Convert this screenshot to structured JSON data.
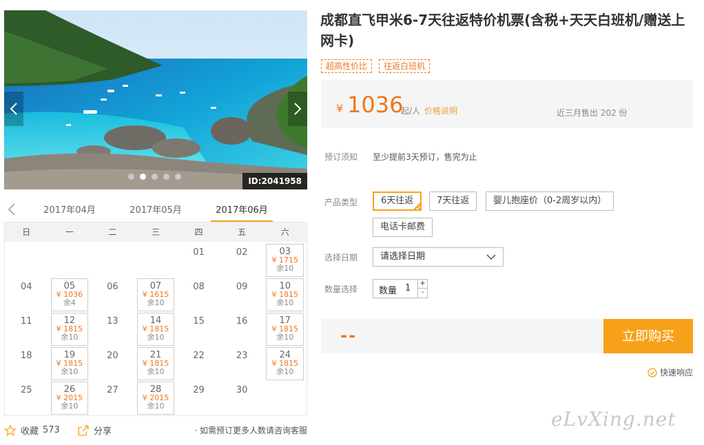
{
  "product": {
    "title": "成都直飞甲米6-7天往返特价机票(含税+天天白班机/赠送上网卡)",
    "tags": [
      "超高性价比",
      "往返白班机"
    ],
    "photo_id": "ID:2041958"
  },
  "price": {
    "currency": "¥",
    "amount": "1036",
    "unit": "起/人",
    "explain_label": "价格说明",
    "sold": "近三月售出 202 份"
  },
  "booking": {
    "notice_label": "预订须知",
    "notice_text": "至少提前3天预订，售完为止",
    "type_label": "产品类型",
    "types": [
      "6天往返",
      "7天往返",
      "婴儿抱座价（0-2周岁以内）",
      "电话卡邮费"
    ],
    "selected_type": "6天往返",
    "date_label": "选择日期",
    "date_placeholder": "请选择日期",
    "qty_label": "数量选择",
    "qty_prefix": "数量",
    "qty_value": "1",
    "qty_plus": "+",
    "qty_minus": "-"
  },
  "buy": {
    "total": "--",
    "button": "立即购买",
    "quick_response": "快速响应"
  },
  "calendar": {
    "months": [
      "2017年04月",
      "2017年05月",
      "2017年06月"
    ],
    "active_month": "2017年06月",
    "weekdays": [
      "日",
      "一",
      "二",
      "三",
      "四",
      "五",
      "六"
    ],
    "leading_blanks": 4,
    "days": [
      {
        "d": "01"
      },
      {
        "d": "02"
      },
      {
        "d": "03",
        "price": "¥ 1715",
        "stock": "余10"
      },
      {
        "d": "04"
      },
      {
        "d": "05",
        "price": "¥ 1036",
        "stock": "余4"
      },
      {
        "d": "06"
      },
      {
        "d": "07",
        "price": "¥ 1615",
        "stock": "余10"
      },
      {
        "d": "08"
      },
      {
        "d": "09"
      },
      {
        "d": "10",
        "price": "¥ 1815",
        "stock": "余10"
      },
      {
        "d": "11"
      },
      {
        "d": "12",
        "price": "¥ 1815",
        "stock": "余10"
      },
      {
        "d": "13"
      },
      {
        "d": "14",
        "price": "¥ 1815",
        "stock": "余10"
      },
      {
        "d": "15"
      },
      {
        "d": "16"
      },
      {
        "d": "17",
        "price": "¥ 1815",
        "stock": "余10"
      },
      {
        "d": "18"
      },
      {
        "d": "19",
        "price": "¥ 1815",
        "stock": "余10"
      },
      {
        "d": "20"
      },
      {
        "d": "21",
        "price": "¥ 1815",
        "stock": "余10"
      },
      {
        "d": "22"
      },
      {
        "d": "23"
      },
      {
        "d": "24",
        "price": "¥ 1815",
        "stock": "余10"
      },
      {
        "d": "25"
      },
      {
        "d": "26",
        "price": "¥ 2015",
        "stock": "余10"
      },
      {
        "d": "27"
      },
      {
        "d": "28",
        "price": "¥ 2015",
        "stock": "余10"
      },
      {
        "d": "29"
      },
      {
        "d": "30"
      }
    ]
  },
  "footer": {
    "favorite_label": "收藏",
    "favorite_count": "573",
    "share_label": "分享",
    "note": "· 如需预订更多人数请咨询客服"
  },
  "watermark": "eLvXing.net",
  "colors": {
    "accent": "#f7a11b",
    "price": "#f0751b"
  }
}
